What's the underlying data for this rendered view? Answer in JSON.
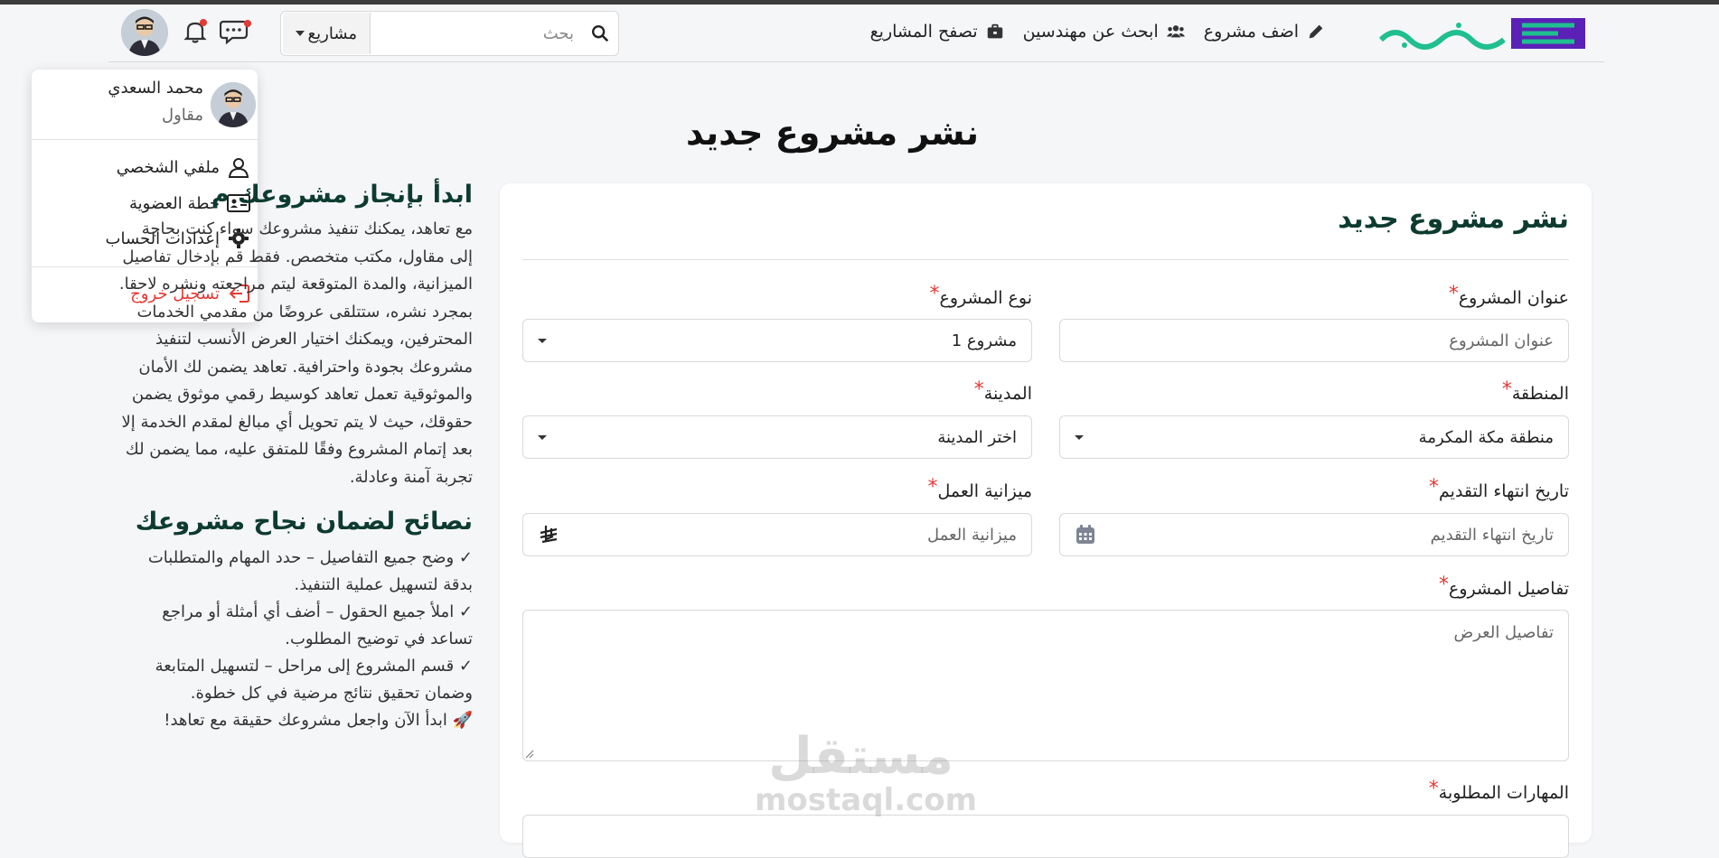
{
  "nav": {
    "links": [
      {
        "label": "اضف مشروع",
        "icon": "pencil-icon"
      },
      {
        "label": "ابحث عن مهندسين",
        "icon": "users-icon"
      },
      {
        "label": "تصفح المشاريع",
        "icon": "briefcase-icon"
      }
    ],
    "search": {
      "placeholder": "بحث",
      "scope": "مشاريع"
    }
  },
  "user_menu": {
    "name": "محمد السعدي",
    "role": "مقاول",
    "items": [
      {
        "label": "ملفي الشخصي",
        "icon": "user-icon"
      },
      {
        "label": "خطة العضوية",
        "icon": "id-card-icon"
      },
      {
        "label": "إعدادات الحساب",
        "icon": "gear-icon"
      }
    ],
    "logout": "تسجيل خروج"
  },
  "page_title": "نشر مشروع جديد",
  "side": {
    "title": "ابدأ بإنجاز مشروعك م",
    "body": "مع تعاهد، يمكنك تنفيذ مشروعك سواء كنت بحاجة إلى مقاول، مكتب متخصص. فقط قم بإدخال تفاصيل الميزانية، والمدة المتوقعة ليتم مراجعته ونشره لاحقا. بمجرد نشره، ستتلقى عروضًا من مقدمي الخدمات المحترفين، ويمكنك اختيار العرض الأنسب لتنفيذ مشروعك بجودة واحترافية. تعاهد يضمن لك الأمان والموثوقية تعمل تعاهد كوسيط رقمي موثوق يضمن حقوقك، حيث لا يتم تحويل أي مبالغ لمقدم الخدمة إلا بعد إتمام المشروع وفقًا للمتفق عليه، مما يضمن لك تجربة آمنة وعادلة.",
    "tips_title": "نصائح لضمان نجاح مشروعك",
    "tips": [
      "✓ وضح جميع التفاصيل – حدد المهام والمتطلبات بدقة لتسهيل عملية التنفيذ.",
      "✓ املأ جميع الحقول – أضف أي أمثلة أو مراجع تساعد في توضيح المطلوب.",
      "✓ قسم المشروع إلى مراحل – لتسهيل المتابعة وضمان تحقيق نتائج مرضية في كل خطوة.",
      "🚀 ابدأ الآن واجعل مشروعك حقيقة مع تعاهد!"
    ]
  },
  "form": {
    "title": "نشر مشروع جديد",
    "fields": {
      "project_title": {
        "label": "عنوان المشروع",
        "placeholder": "عنوان المشروع"
      },
      "project_type": {
        "label": "نوع المشروع",
        "value": "مشروع 1"
      },
      "region": {
        "label": "المنطقة",
        "value": "منطقة مكة المكرمة"
      },
      "city": {
        "label": "المدينة",
        "value": "اختر المدينة"
      },
      "deadline": {
        "label": "تاريخ انتهاء التقديم",
        "placeholder": "تاريخ انتهاء التقديم"
      },
      "budget": {
        "label": "ميزانية العمل",
        "placeholder": "ميزانية العمل"
      },
      "details": {
        "label": "تفاصيل المشروع",
        "placeholder": "تفاصيل العرض"
      },
      "skills": {
        "label": "المهارات المطلوبة"
      }
    },
    "required_mark": "*"
  },
  "watermark": {
    "ar": "مستقل",
    "en": "mostaql.com"
  },
  "colors": {
    "brand_purple": "#5b21b6",
    "brand_green": "#1fbf8f",
    "heading_green": "#0d3b30",
    "required_red": "#e53935"
  }
}
